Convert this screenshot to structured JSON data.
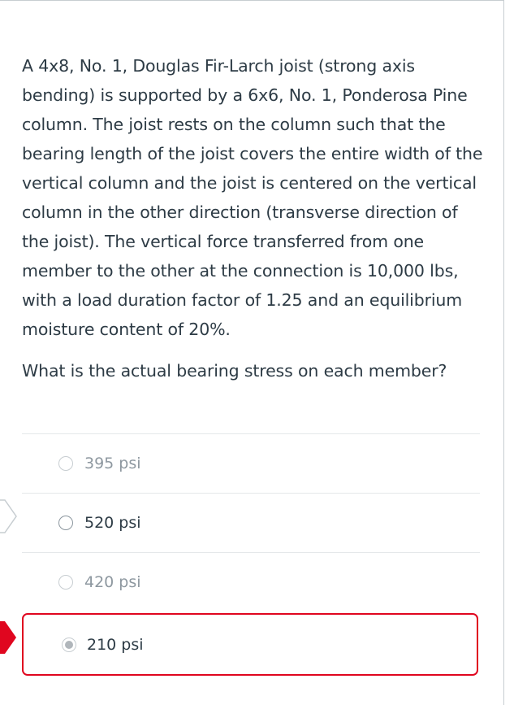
{
  "question": {
    "paragraph": "A 4x8, No. 1, Douglas Fir-Larch joist (strong axis bending) is supported by a 6x6, No. 1, Ponderosa Pine column.  The joist rests on the column such that the bearing length of the joist covers the entire width of the vertical column and the joist is centered on the vertical column in the other direction (transverse direction of the joist).  The vertical force transferred from one member to the other at the connection is 10,000 lbs, with a load duration factor of 1.25 and an equilibrium moisture content of 20%.",
    "prompt": "What is the actual bearing stress on each member?"
  },
  "answers": [
    {
      "label": "395 psi",
      "selected": false,
      "marker": "none"
    },
    {
      "label": "520 psi",
      "selected": false,
      "marker": "correct-answer-arrow"
    },
    {
      "label": "420 psi",
      "selected": false,
      "marker": "none"
    },
    {
      "label": "210 psi",
      "selected": true,
      "marker": "incorrect-answer-arrow"
    }
  ],
  "colors": {
    "incorrect": "#e0061f",
    "text": "#2d3b45",
    "muted_text": "#8e98a0"
  }
}
